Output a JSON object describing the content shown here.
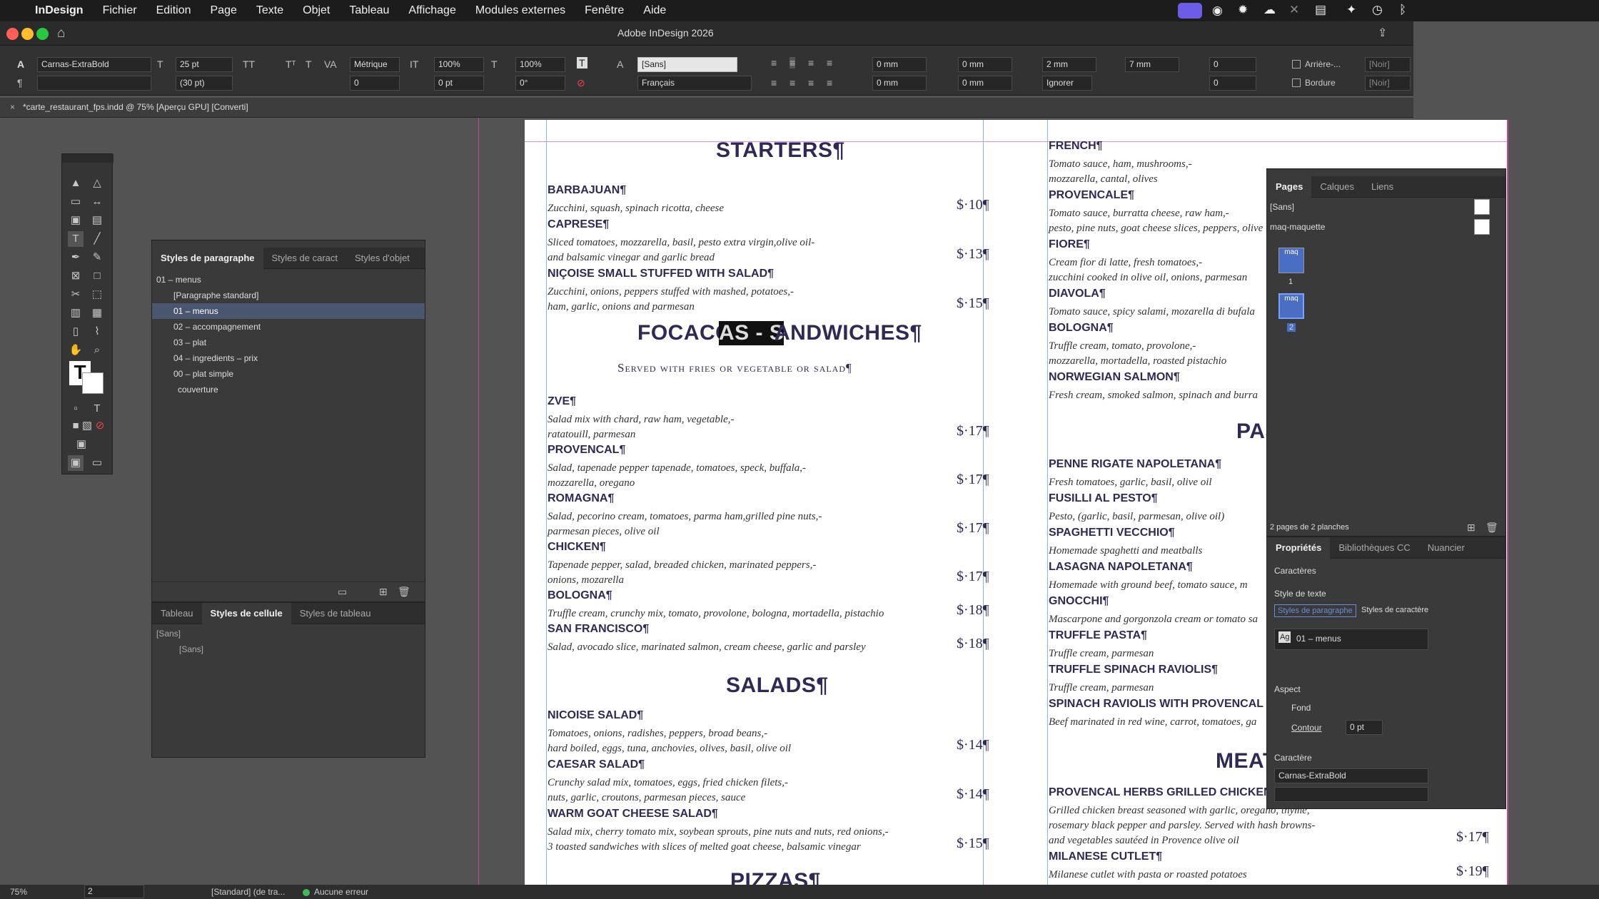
{
  "menubar": {
    "app": "InDesign",
    "items": [
      "Fichier",
      "Edition",
      "Page",
      "Texte",
      "Objet",
      "Tableau",
      "Affichage",
      "Modules externes",
      "Fenêtre",
      "Aide"
    ]
  },
  "window": {
    "title": "Adobe InDesign 2026"
  },
  "control": {
    "font": "Carnas-ExtraBold",
    "size": "25 pt",
    "leading": "(30 pt)",
    "kerning": "Métrique",
    "tracking": "0",
    "hscale": "100%",
    "vscale": "100%",
    "baseline": "0 pt",
    "skew": "0°",
    "char_style": "[Sans]",
    "language": "Français",
    "indent_left": "0 mm",
    "indent_right": "0 mm",
    "first_indent": "0 mm",
    "last_indent": "0 mm",
    "space_before": "2 mm",
    "space_after": "7 mm",
    "dropcap": "0",
    "dropcap2": "0",
    "hyphen": "Ignorer",
    "arriere_label": "Arrière-...",
    "bordure_label": "Bordure",
    "swatch1": "[Noir]",
    "swatch2": "[Noir]"
  },
  "doc_tab": {
    "label": "*carte_restaurant_fps.indd @ 75% [Aperçu GPU] [Converti]"
  },
  "para_panel": {
    "tabs": [
      "Styles de paragraphe",
      "Styles de caract",
      "Styles d'objet"
    ],
    "current": "01 – menus",
    "items": [
      "[Paragraphe standard]",
      "01 – menus",
      "02 – accompagnement",
      "03 – plat",
      "04 – ingredients – prix",
      "00 – plat simple"
    ],
    "group": "couverture"
  },
  "cell_panel": {
    "tabs": [
      "Tableau",
      "Styles de cellule",
      "Styles de tableau"
    ],
    "current": "[Sans]",
    "items": [
      "[Sans]"
    ]
  },
  "pages_panel": {
    "tabs": [
      "Pages",
      "Calques",
      "Liens"
    ],
    "masters": [
      "[Sans]",
      "maq-maquette"
    ],
    "thumb_labels": [
      "maq",
      "maq"
    ],
    "page_numbers": [
      "1",
      "2"
    ],
    "footer": "2 pages de 2 planches"
  },
  "props_panel": {
    "tabs": [
      "Propriétés",
      "Bibliothèques CC",
      "Nuancier"
    ],
    "section": "Caractères",
    "text_style_label": "Style de texte",
    "subtabs": [
      "Styles de paragraphe",
      "Styles de caractère"
    ],
    "style_value": "01 – menus",
    "style_badge": "Ag",
    "aspect_label": "Aspect",
    "fond": "Fond",
    "contour": "Contour",
    "contour_value": "0 pt",
    "char_label": "Caractère",
    "font": "Carnas-ExtraBold"
  },
  "status": {
    "zoom": "75%",
    "page": "2",
    "style": "[Standard] (de tra...",
    "errors": "Aucune erreur"
  },
  "menu": {
    "starters": "STARTERS¶",
    "starters_items": [
      {
        "name": "BARBAJUAN¶",
        "desc": [
          "Zucchini, squash, spinach ricotta, cheese"
        ],
        "price": "$·10¶"
      },
      {
        "name": "CAPRESE¶",
        "desc": [
          "Sliced tomatoes, mozzarella, basil, pesto extra virgin,olive oil-",
          "and balsamic vinegar and garlic bread"
        ],
        "price": "$·13¶"
      },
      {
        "name": "NIÇOISE SMALL STUFFED WITH SALAD¶",
        "desc": [
          "Zucchini, onions, peppers stuffed with mashed, potatoes,-",
          "ham, garlic, onions and parmesan"
        ],
        "price": "$·15¶"
      }
    ],
    "foc_a": "FOCACCI",
    "foc_b": "AS - S",
    "foc_c": "ANDWICHES¶",
    "foc_sub": "Served with fries or vegetable or salad¶",
    "foc_items": [
      {
        "name": "ZVE¶",
        "desc": [
          "Salad mix with chard, raw ham, vegetable,-",
          "ratatouill, parmesan"
        ],
        "price": "$·17¶"
      },
      {
        "name": "PROVENCAL¶",
        "desc": [
          "Salad, tapenade pepper tapenade, tomatoes, speck, buffala,-",
          "mozzarella, oregano"
        ],
        "price": "$·17¶"
      },
      {
        "name": "ROMAGNA¶",
        "desc": [
          "Salad, pecorino cream, tomatoes, parma ham,grilled pine nuts,-",
          "parmesan pieces, olive oil"
        ],
        "price": "$·17¶"
      },
      {
        "name": "CHICKEN¶",
        "desc": [
          "Tapenade pepper, salad, breaded chicken, marinated peppers,-",
          "onions, mozarella"
        ],
        "price": "$·17¶"
      },
      {
        "name": "BOLOGNA¶",
        "desc": [
          "Truffle cream, crunchy mix, tomato, provolone, bologna, mortadella, pistachio"
        ],
        "price": "$·18¶"
      },
      {
        "name": "SAN FRANCISCO¶",
        "desc": [
          "Salad, avocado slice, marinated salmon, cream cheese, garlic and parsley"
        ],
        "price": "$·18¶"
      }
    ],
    "salads": "SALADS¶",
    "salad_items": [
      {
        "name": "NICOISE SALAD¶",
        "desc": [
          "Tomatoes, onions, radishes, peppers, broad beans,-",
          "hard boiled, eggs, tuna, anchovies, olives, basil, olive oil"
        ],
        "price": "$·14¶"
      },
      {
        "name": "CAESAR SALAD¶",
        "desc": [
          "Crunchy salad mix, tomatoes, eggs, fried chicken filets,-",
          "nuts, garlic, croutons, parmesan pieces, sauce"
        ],
        "price": "$·14¶"
      },
      {
        "name": "WARM GOAT CHEESE SALAD¶",
        "desc": [
          "Salad mix, cherry tomato mix, soybean sprouts, pine nuts and nuts, red onions,-",
          "3 toasted sandwiches with slices of melted goat cheese, balsamic vinegar"
        ],
        "price": "$·15¶"
      }
    ],
    "pizzas": "PIZZAS¶",
    "right_items": [
      {
        "name": "FRENCH¶",
        "desc": [
          "Tomato sauce, ham, mushrooms,-",
          "mozzarella, cantal, olives"
        ]
      },
      {
        "name": "PROVENCALE¶",
        "desc": [
          "Tomato sauce, burratta cheese, raw ham,-",
          "pesto, pine nuts, goat cheese slices, peppers, olive"
        ]
      },
      {
        "name": "FIORE¶",
        "desc": [
          "Cream fior di latte, fresh tomatoes,-",
          "zucchini cooked in olive oil, onions, parmesan"
        ]
      },
      {
        "name": "DIAVOLA¶",
        "desc": [
          "Tomato sauce, spicy salami, mozarella di bufala"
        ]
      },
      {
        "name": "BOLOGNA¶",
        "desc": [
          "Truffle cream, tomato, provolone,-",
          "mozzarella, mortadella, roasted pistachio"
        ]
      },
      {
        "name": "NORWEGIAN SALMON¶",
        "desc": [
          "Fresh cream, smoked salmon, spinach and burra"
        ]
      }
    ],
    "pas": "PAS",
    "pasta_items": [
      {
        "name": "PENNE RIGATE NAPOLETANA¶",
        "desc": [
          "Fresh tomatoes, garlic, basil, olive oil"
        ]
      },
      {
        "name": "FUSILLI AL PESTO¶",
        "desc": [
          "Pesto, (garlic, basil, parmesan, olive oil)"
        ]
      },
      {
        "name": "SPAGHETTI VECCHIO¶",
        "desc": [
          "Homemade spaghetti and meatballs"
        ]
      },
      {
        "name": "LASAGNA NAPOLETANA¶",
        "desc": [
          "Homemade with ground beef, tomato sauce, m"
        ]
      },
      {
        "name": "GNOCCHI¶",
        "desc": [
          "Mascarpone and gorgonzola cream or tomato sa"
        ]
      },
      {
        "name": "TRUFFLE PASTA¶",
        "desc": [
          "Truffle cream, parmesan"
        ]
      },
      {
        "name": "TRUFFLE SPINACH RAVIOLIS¶",
        "desc": [
          "Truffle cream, parmesan"
        ]
      },
      {
        "name": "SPINACH RAVIOLIS WITH PROVENCAL BEEF",
        "desc": [
          "Beef marinated in red wine, carrot, tomatoes, ga"
        ]
      }
    ],
    "meat": "MEAT",
    "meat_items": [
      {
        "name": "PROVENCAL HERBS GRILLED CHICKEN¶",
        "desc": [
          "Grilled chicken breast seasoned with garlic, oregano, thyme,",
          "rosemary black pepper and parsley. Served with hash browns-",
          "and vegetables sautéed in Provence olive oil"
        ],
        "price": "$·17¶"
      },
      {
        "name": "MILANESE CUTLET¶",
        "desc": [
          "Milanese cutlet with pasta or roasted potatoes"
        ],
        "price": "$·19¶"
      }
    ]
  }
}
